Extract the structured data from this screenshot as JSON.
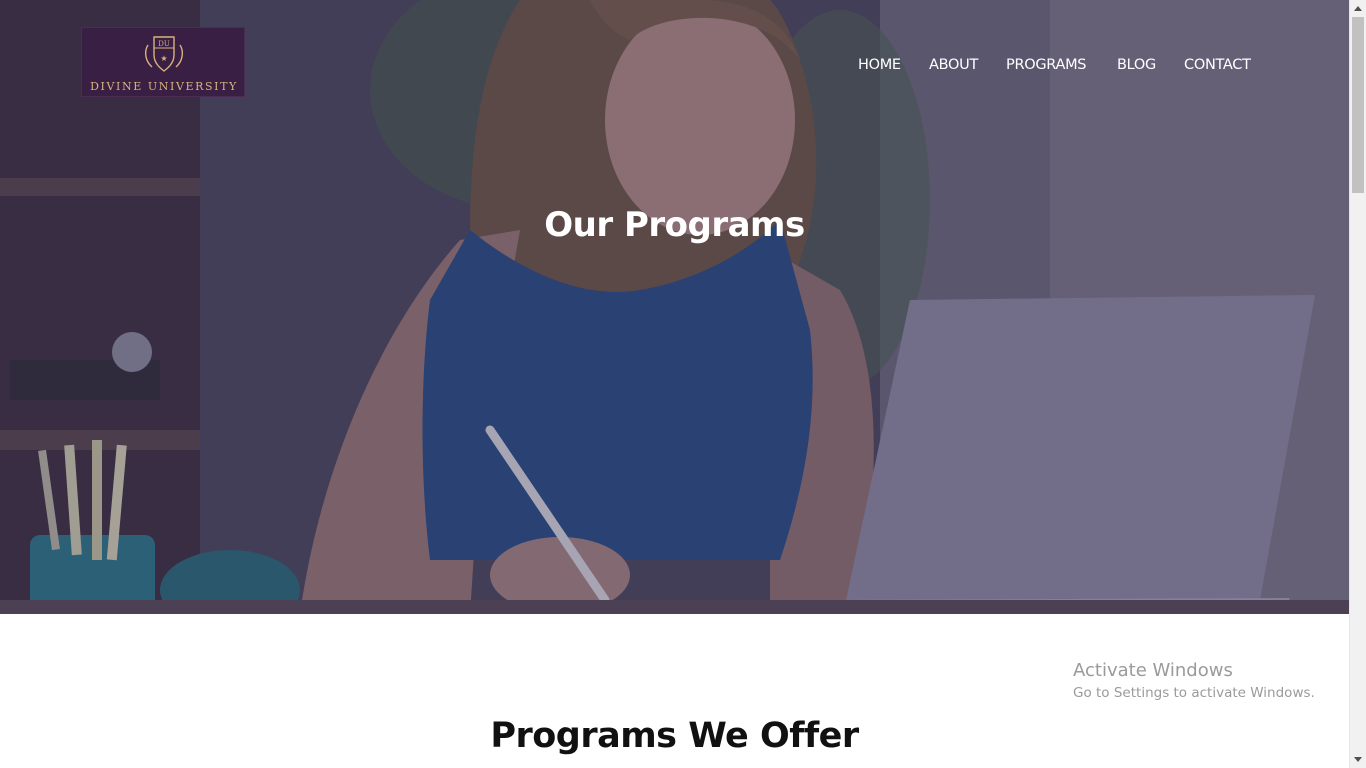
{
  "brand": {
    "name": "DIVINE UNIVERSITY",
    "crest_initials": "DU",
    "colors": {
      "logo_background": "#3a1f45",
      "logo_gold": "#d8b27a"
    }
  },
  "nav": {
    "items": [
      {
        "label": "HOME"
      },
      {
        "label": "ABOUT"
      },
      {
        "label": "PROGRAMS"
      },
      {
        "label": "BLOG"
      },
      {
        "label": "CONTACT"
      }
    ]
  },
  "hero": {
    "title": "Our Programs",
    "image": "student-writing-at-laptop-photo"
  },
  "main": {
    "section_title": "Programs We Offer"
  },
  "os_watermark": {
    "line1": "Activate Windows",
    "line2": "Go to Settings to activate Windows."
  }
}
